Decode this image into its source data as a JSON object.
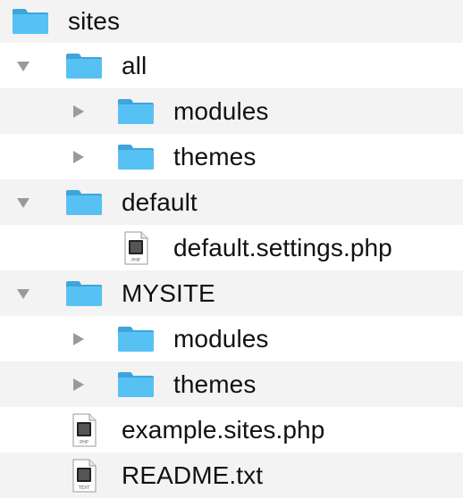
{
  "tree": {
    "root": {
      "label": "sites",
      "icon": "folder-icon"
    },
    "all": {
      "label": "all",
      "state": "expanded",
      "children": [
        {
          "label": "modules",
          "icon": "folder-icon",
          "state": "collapsed"
        },
        {
          "label": "themes",
          "icon": "folder-icon",
          "state": "collapsed"
        }
      ]
    },
    "default": {
      "label": "default",
      "state": "expanded",
      "children": [
        {
          "label": "default.settings.php",
          "icon": "php-file-icon",
          "badge": "PHP"
        }
      ]
    },
    "mysite": {
      "label": "MYSITE",
      "state": "expanded",
      "children": [
        {
          "label": "modules",
          "icon": "folder-icon",
          "state": "collapsed"
        },
        {
          "label": "themes",
          "icon": "folder-icon",
          "state": "collapsed"
        }
      ]
    },
    "files": [
      {
        "label": "example.sites.php",
        "icon": "php-file-icon",
        "badge": "PHP"
      },
      {
        "label": "README.txt",
        "icon": "text-file-icon",
        "badge": "TEXT"
      }
    ]
  },
  "colors": {
    "folder_body": "#58C1F4",
    "folder_tab": "#3FA4DC",
    "row_alt": "#F3F3F3",
    "arrow": "#9A9A9A"
  }
}
